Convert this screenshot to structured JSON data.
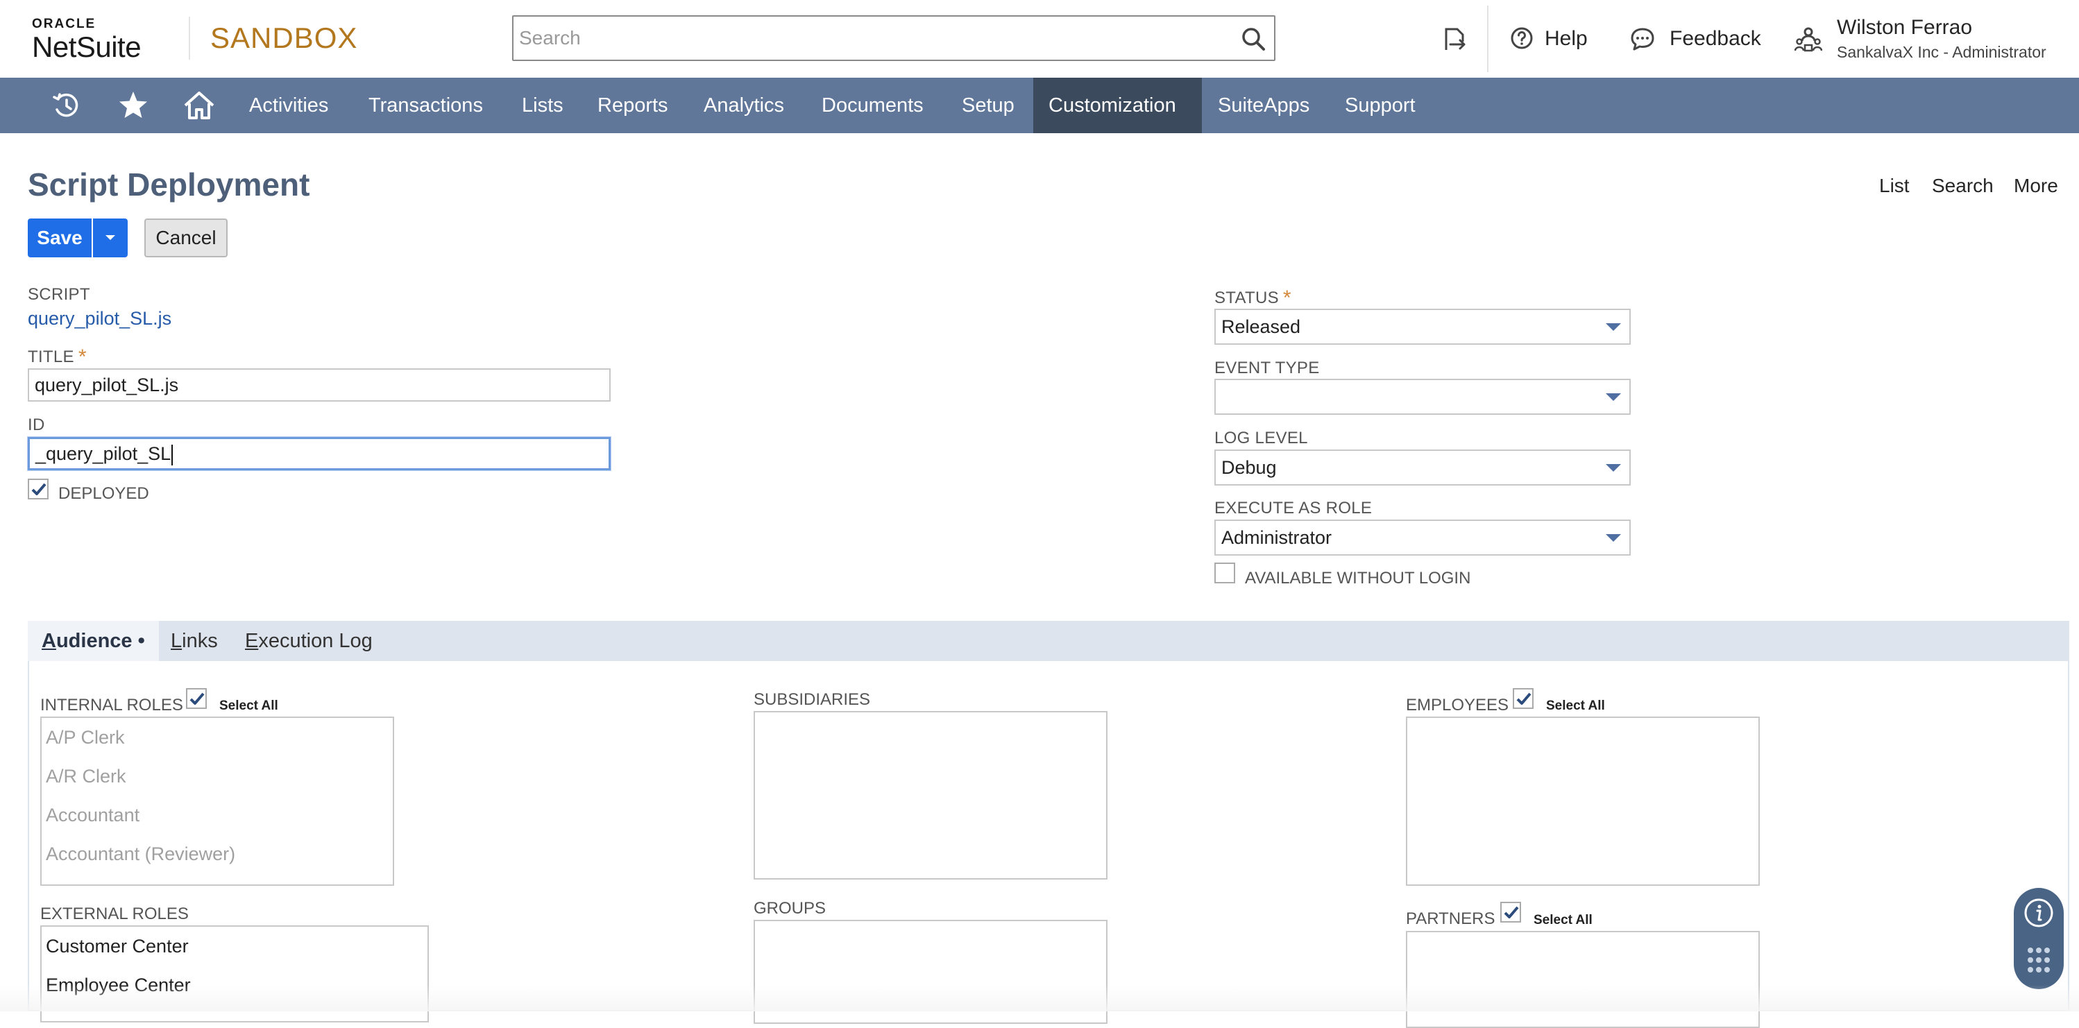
{
  "header": {
    "logo_oracle": "ORACLE",
    "logo_netsuite": "NetSuite",
    "environment": "SANDBOX",
    "search_placeholder": "Search",
    "help_label": "Help",
    "feedback_label": "Feedback",
    "user_name": "Wilston Ferrao",
    "user_org": "SankalvaX Inc - Administrator"
  },
  "nav": {
    "items": [
      "Activities",
      "Transactions",
      "Lists",
      "Reports",
      "Analytics",
      "Documents",
      "Setup",
      "Customization",
      "SuiteApps",
      "Support"
    ],
    "active": "Customization"
  },
  "page": {
    "title": "Script Deployment",
    "links": [
      "List",
      "Search",
      "More"
    ],
    "save_label": "Save",
    "cancel_label": "Cancel"
  },
  "form": {
    "script_label": "SCRIPT",
    "script_value": "query_pilot_SL.js",
    "title_label": "TITLE",
    "title_value": "query_pilot_SL.js",
    "id_label": "ID",
    "id_value": "_query_pilot_SL",
    "deployed_label": "DEPLOYED",
    "deployed_checked": true,
    "status_label": "STATUS",
    "status_value": "Released",
    "event_type_label": "EVENT TYPE",
    "event_type_value": "",
    "log_level_label": "LOG LEVEL",
    "log_level_value": "Debug",
    "execute_as_role_label": "EXECUTE AS ROLE",
    "execute_as_role_value": "Administrator",
    "available_without_login_label": "AVAILABLE WITHOUT LOGIN",
    "available_without_login_checked": false
  },
  "tabs": {
    "audience": {
      "first": "A",
      "rest": "udience",
      "dot": " •"
    },
    "links": {
      "first": "L",
      "rest": "inks"
    },
    "execution_log": {
      "first": "E",
      "rest": "xecution Log"
    }
  },
  "audience": {
    "select_all_label": "Select All",
    "internal_roles_label": "INTERNAL ROLES",
    "internal_roles": [
      "A/P Clerk",
      "A/R Clerk",
      "Accountant",
      "Accountant (Reviewer)"
    ],
    "external_roles_label": "EXTERNAL ROLES",
    "external_roles": [
      "Customer Center",
      "Employee Center"
    ],
    "subsidiaries_label": "SUBSIDIARIES",
    "groups_label": "GROUPS",
    "employees_label": "EMPLOYEES",
    "partners_label": "PARTNERS"
  },
  "colors": {
    "navbar": "#607799",
    "navbar_active": "#3c4a5e",
    "primary_button": "#1f6ee8",
    "title": "#4d5f79",
    "environment": "#b3771e",
    "required": "#d5883a",
    "link": "#255ba8"
  }
}
